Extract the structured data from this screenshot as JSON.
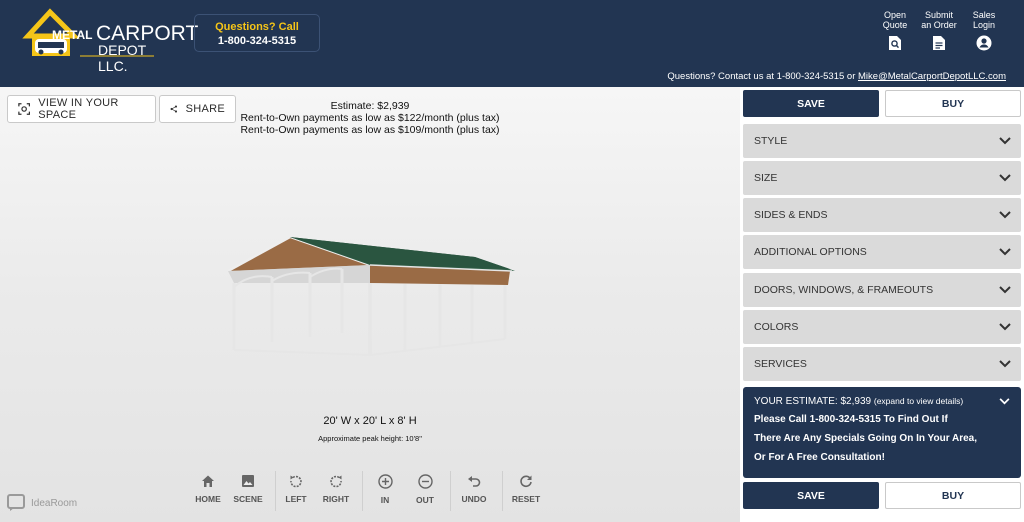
{
  "header": {
    "logo": {
      "word1": "METAL",
      "word2": "CARPORT",
      "word3": "DEPOT LLC."
    },
    "call_box": {
      "title": "Questions? Call",
      "phone": "1-800-324-5315"
    },
    "links": [
      {
        "label_line1": "Open",
        "label_line2": "Quote",
        "icon": "open-quote-icon"
      },
      {
        "label_line1": "Submit",
        "label_line2": "an Order",
        "icon": "document-icon"
      },
      {
        "label_line1": "Sales",
        "label_line2": "Login",
        "icon": "user-icon"
      }
    ],
    "contact": {
      "prefix": "Questions? Contact us at 1-800-324-5315 or ",
      "email": "Mike@MetalCarportDepotLLC.com"
    }
  },
  "viewport": {
    "view_in_space": "VIEW IN YOUR SPACE",
    "share": "SHARE",
    "estimate_line": "Estimate: $2,939",
    "rent_line1": "Rent-to-Own payments as low as $122/month (plus tax)",
    "rent_line2": "Rent-to-Own payments as low as $109/month (plus tax)",
    "dimensions": "20' W x 20' L x 8' H",
    "peak_height": "Approximate peak height: 10'8\"",
    "controls": {
      "home": "HOME",
      "scene": "SCENE",
      "left": "LEFT",
      "right": "RIGHT",
      "in": "IN",
      "out": "OUT",
      "undo": "UNDO",
      "reset": "RESET"
    },
    "brand": "IdeaRoom",
    "colors": {
      "roof": "#2f5d45",
      "walls": "#9a6b45",
      "frame": "#e6e6e6"
    }
  },
  "panel": {
    "save": "SAVE",
    "buy": "BUY",
    "sections": [
      "STYLE",
      "SIZE",
      "SIDES & ENDS",
      "ADDITIONAL OPTIONS",
      "DOORS, WINDOWS, & FRAMEOUTS",
      "COLORS",
      "SERVICES"
    ],
    "estimate": {
      "label": "YOUR ESTIMATE:",
      "value": "$2,939",
      "hint": "(expand to view details)",
      "message_line1": "Please Call 1-800-324-5315 To Find Out If",
      "message_line2": "There Are Any Specials Going On In Your Area,",
      "message_line3": "Or For A Free Consultation!"
    }
  },
  "theme": {
    "navy": "#223552",
    "accent": "#f5c518",
    "accordion": "#dadada"
  }
}
